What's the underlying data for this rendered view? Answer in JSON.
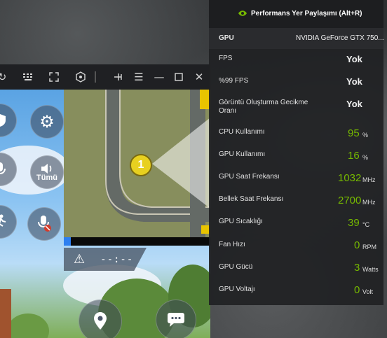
{
  "overlay": {
    "title": "Performans Yer Paylaşımı (Alt+R)",
    "gpu_label": "GPU",
    "gpu_value": "NVIDIA GeForce GTX 750...",
    "metrics": [
      {
        "label": "FPS",
        "value": "Yok",
        "unit": ""
      },
      {
        "label": "%99 FPS",
        "value": "Yok",
        "unit": ""
      },
      {
        "label": "Görüntü Oluşturma Gecikme Oranı",
        "value": "Yok",
        "unit": ""
      },
      {
        "label": "CPU Kullanımı",
        "value": "95",
        "unit": "%"
      },
      {
        "label": "GPU Kullanımı",
        "value": "16",
        "unit": "%"
      },
      {
        "label": "GPU Saat Frekansı",
        "value": "1032",
        "unit": "MHz"
      },
      {
        "label": "Bellek Saat Frekansı",
        "value": "2700",
        "unit": "MHz"
      },
      {
        "label": "GPU Sıcaklığı",
        "value": "39",
        "unit": "°C"
      },
      {
        "label": "Fan Hızı",
        "value": "0",
        "unit": "RPM"
      },
      {
        "label": "GPU Gücü",
        "value": "3",
        "unit": "Watts"
      },
      {
        "label": "GPU Voltajı",
        "value": "0",
        "unit": "Volt"
      }
    ],
    "accent_green": "#76b900"
  },
  "emulator": {
    "toolbar_icons": [
      "rotate-icon",
      "keyboard-icon",
      "fullscreen-icon",
      "gamepad-icon",
      "pin-icon",
      "menu-icon",
      "minimize-icon",
      "maximize-icon",
      "close-icon"
    ]
  },
  "game": {
    "all_label": "Tümü",
    "timer": "--:--",
    "marker_number": "1",
    "progress": 0.05
  }
}
